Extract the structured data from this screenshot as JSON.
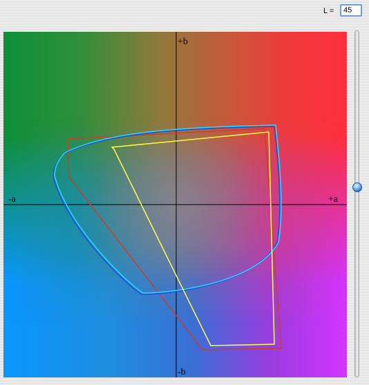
{
  "lightness": {
    "label": "L =",
    "value": "45",
    "min": 0,
    "max": 100,
    "fraction": 0.55
  },
  "plot": {
    "axis_labels": {
      "positive_b": "+b",
      "negative_b": "-b",
      "negative_a": "-a",
      "positive_a": "+a"
    },
    "gamut_colors": {
      "red_outline": "#c8402c",
      "blue_outline": "#1e4fd8",
      "cyan_outline": "#28d8ff",
      "yellow_outline": "#ffff40"
    }
  }
}
